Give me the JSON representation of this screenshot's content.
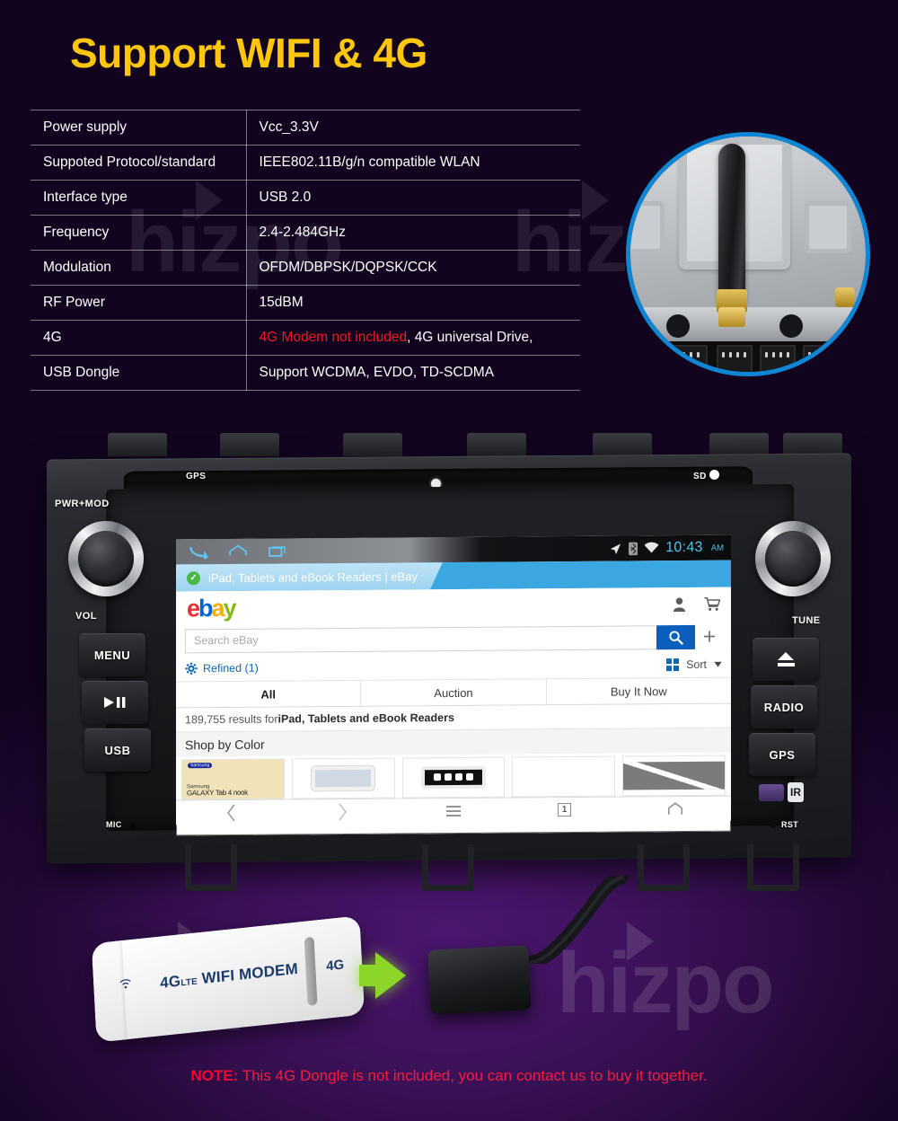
{
  "headline": "Support WIFI & 4G",
  "watermark": {
    "text": "hizpo"
  },
  "spec_table": {
    "rows": [
      {
        "key": "Power supply",
        "value": "Vcc_3.3V"
      },
      {
        "key": "Suppoted Protocol/standard",
        "value": "IEEE802.11B/g/n compatible WLAN"
      },
      {
        "key": "Interface  type",
        "value": "USB 2.0"
      },
      {
        "key": "Frequency",
        "value": "2.4-2.484GHz"
      },
      {
        "key": "Modulation",
        "value": "OFDM/DBPSK/DQPSK/CCK"
      },
      {
        "key": "RF Power",
        "value": "15dBM"
      },
      {
        "key": "4G",
        "value_red": "4G Modem not included",
        "value": ", 4G universal Drive,"
      },
      {
        "key": "USB Dongle",
        "value": "Support WCDMA, EVDO, TD-SCDMA"
      }
    ]
  },
  "antenna_inset": {
    "label": "wifi-antenna-photo",
    "ring_color": "#0e86d4"
  },
  "head_unit": {
    "labels": {
      "gps_top": "GPS",
      "sd": "SD",
      "pwr_mod": "PWR+MOD",
      "vol": "VOL",
      "tune": "TUNE",
      "mic": "MIC",
      "rst": "RST",
      "ir": "IR"
    },
    "buttons_left": [
      "MENU",
      "▶❙❙",
      "USB"
    ],
    "button_menu": "MENU",
    "button_usb": "USB",
    "buttons_right": [
      "RADIO",
      "GPS"
    ],
    "button_radio": "RADIO",
    "button_gps": "GPS"
  },
  "screen": {
    "status_bar": {
      "time": "10:43",
      "ampm": "AM",
      "icons": [
        "location-arrow-icon",
        "bluetooth-icon",
        "wifi-icon"
      ]
    },
    "browser_tab": {
      "title": "iPad, Tablets and eBook Readers | eBay",
      "secure_badge": "✓"
    },
    "ebay": {
      "logo": {
        "e": "e",
        "b": "b",
        "a": "a",
        "y": "y"
      },
      "search_placeholder": "Search eBay",
      "search_value": "",
      "refined_label": "Refined (1)",
      "sort_label": "Sort",
      "tabs": [
        "All",
        "Auction",
        "Buy It Now"
      ],
      "active_tab": "All",
      "results_count": "189,755",
      "results_prefix": "189,755 results for ",
      "results_query": "iPad, Tablets and eBook Readers",
      "shop_by_color": "Shop by Color",
      "thumbs": [
        {
          "brand": "Samsung",
          "line1": "Samsung",
          "line2": "GALAXY Tab 4 nook"
        },
        {
          "brand": "",
          "line1": "",
          "line2": ""
        },
        {
          "brand": "",
          "line1": "",
          "line2": ""
        },
        {
          "brand": "",
          "line1": "",
          "line2": ""
        },
        {
          "brand": "",
          "line1": "",
          "line2": ""
        }
      ]
    },
    "browser_nav": {
      "back": "‹",
      "forward": "›",
      "menu": "menu-icon",
      "tab_count": "1",
      "home": "home-icon"
    }
  },
  "dongle": {
    "text": "4G",
    "lte": "LTE",
    "modem": " WIFI MODEM",
    "secondary": "4G"
  },
  "note": {
    "prefix": "NOTE:",
    "text": " This 4G Dongle is not included, you can contact us to buy it together."
  },
  "colors": {
    "headline": "#ffc60b",
    "note": "#f41d3f",
    "warning_red": "#ec1c24",
    "ring_blue": "#0e86d4",
    "ebay_blue": "#0a5fbd",
    "arrow_green": "#8bd629"
  }
}
